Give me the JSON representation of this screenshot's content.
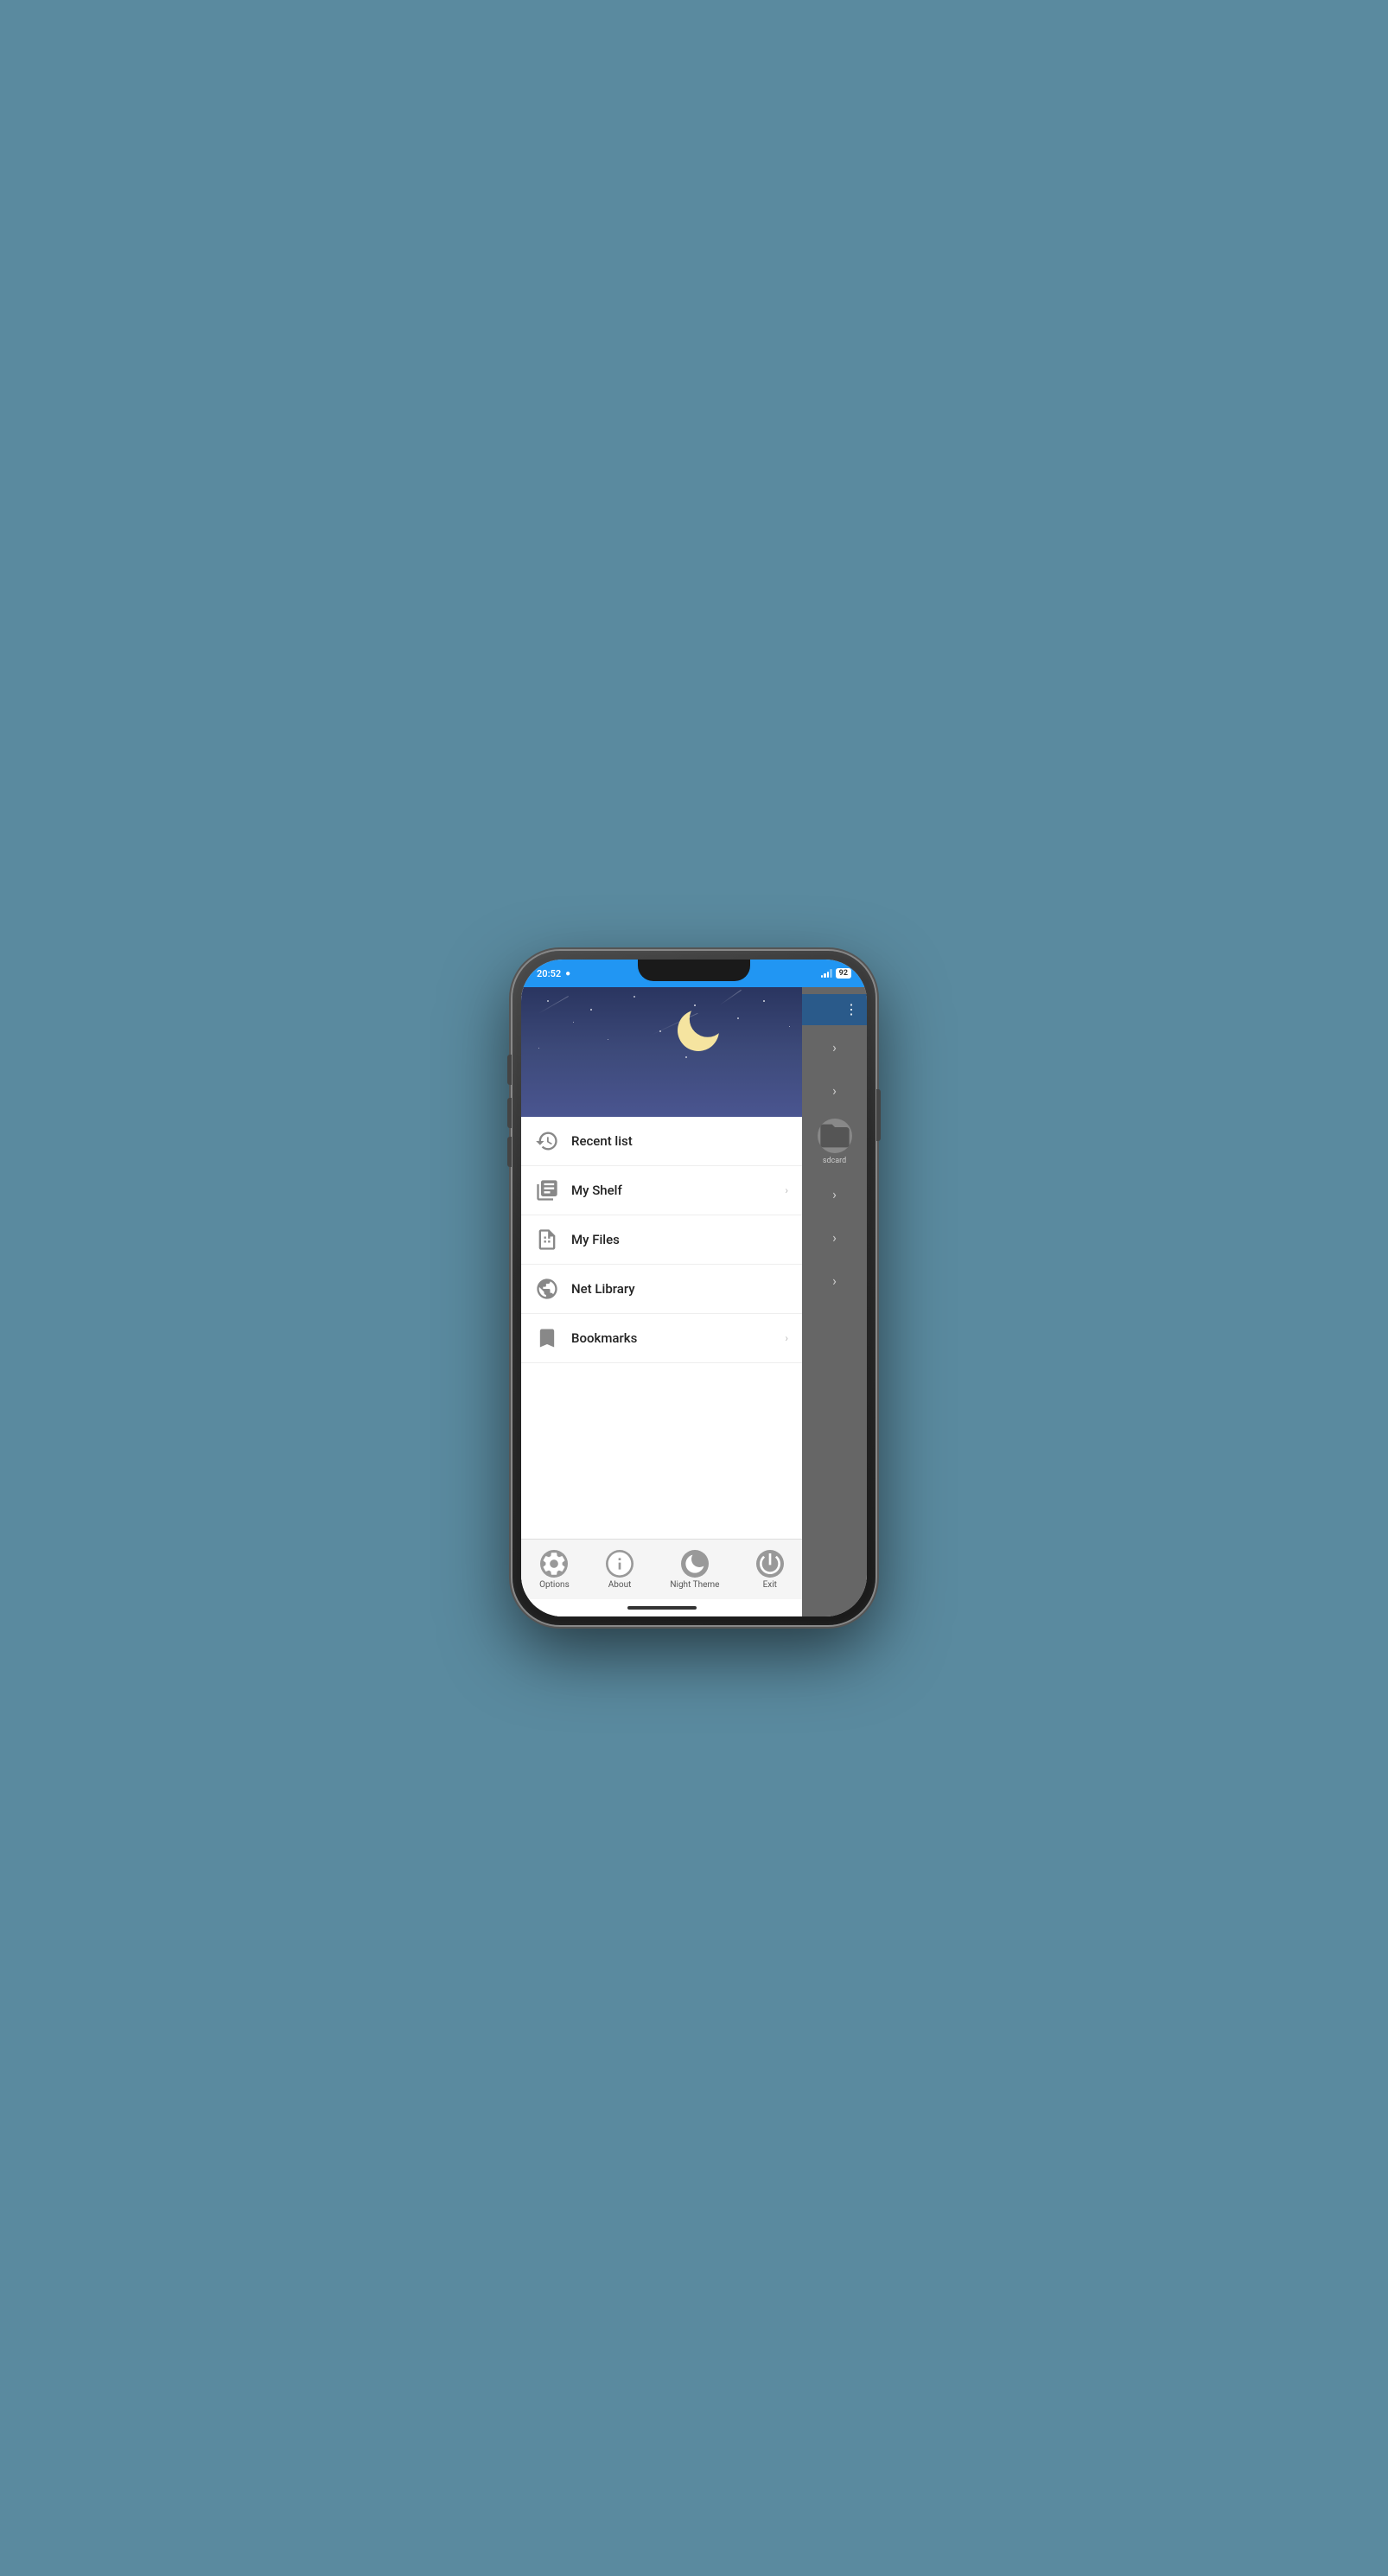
{
  "status_bar": {
    "time": "20:52",
    "battery": "92",
    "whatsapp_icon": "💬"
  },
  "right_panel": {
    "dots": "⋮",
    "sdcard_label": "sdcard"
  },
  "drawer_header": {
    "moon_visible": true
  },
  "menu_items": [
    {
      "id": "recent-list",
      "label": "Recent list",
      "has_chevron": false,
      "icon": "history"
    },
    {
      "id": "my-shelf",
      "label": "My Shelf",
      "has_chevron": true,
      "icon": "books"
    },
    {
      "id": "my-files",
      "label": "My Files",
      "has_chevron": false,
      "icon": "file"
    },
    {
      "id": "net-library",
      "label": "Net Library",
      "has_chevron": false,
      "icon": "globe"
    },
    {
      "id": "bookmarks",
      "label": "Bookmarks",
      "has_chevron": true,
      "icon": "bookmark"
    }
  ],
  "toolbar": {
    "buttons": [
      {
        "id": "options",
        "label": "Options",
        "icon": "gear"
      },
      {
        "id": "about",
        "label": "About",
        "icon": "info"
      },
      {
        "id": "night-theme",
        "label": "Night Theme",
        "icon": "moon"
      },
      {
        "id": "exit",
        "label": "Exit",
        "icon": "power"
      }
    ]
  }
}
